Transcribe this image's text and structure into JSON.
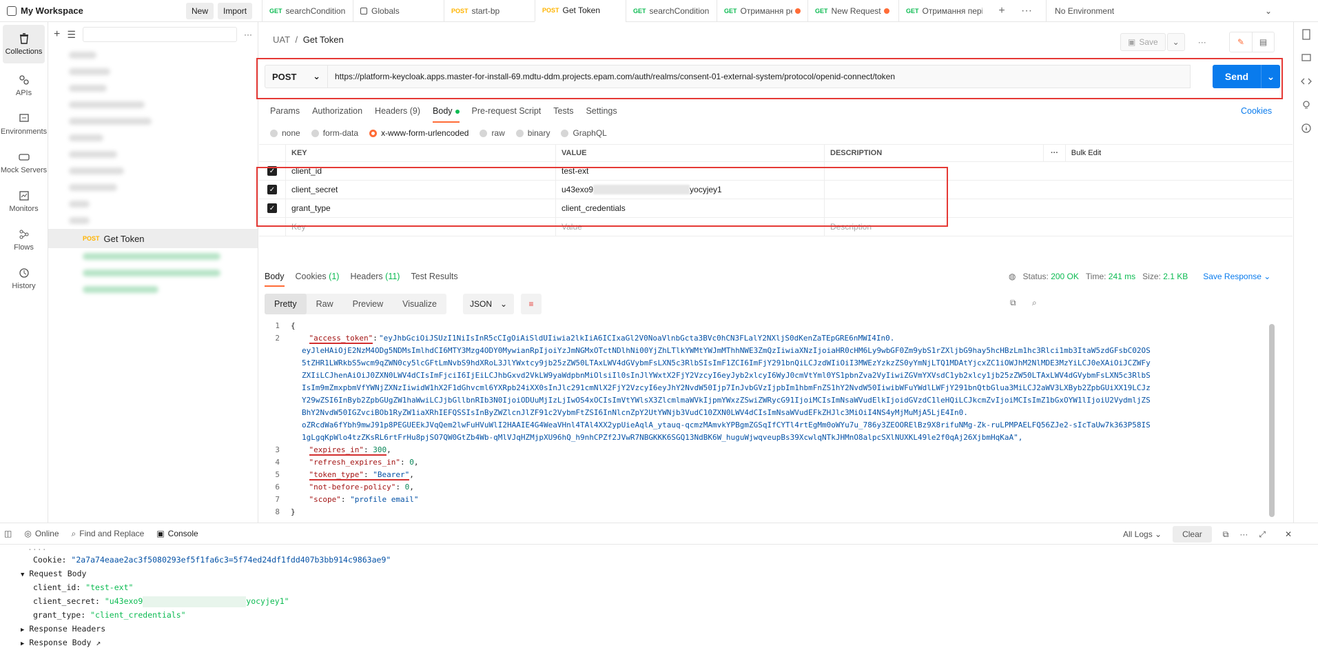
{
  "topbar": {
    "workspace": "My Workspace",
    "new_label": "New",
    "import_label": "Import",
    "tabs": [
      {
        "method": "GET",
        "name": "searchConditionB",
        "dot": false
      },
      {
        "method": "",
        "name": "Globals",
        "dot": false
      },
      {
        "method": "POST",
        "name": "start-bp",
        "dot": false
      },
      {
        "method": "POST",
        "name": "Get Token",
        "dot": false
      },
      {
        "method": "GET",
        "name": "searchConditionB",
        "dot": false
      },
      {
        "method": "GET",
        "name": "Отримання ре",
        "dot": true
      },
      {
        "method": "GET",
        "name": "New Request",
        "dot": true
      },
      {
        "method": "GET",
        "name": "Отримання періо",
        "dot": false
      }
    ],
    "environment": "No Environment"
  },
  "rail": {
    "items": [
      "Collections",
      "APIs",
      "Environments",
      "Mock Servers",
      "Monitors",
      "Flows",
      "History"
    ]
  },
  "sidebar": {
    "selected_method": "POST",
    "selected_name": "Get Token"
  },
  "request": {
    "breadcrumb_parent": "UAT",
    "breadcrumb_sep": "/",
    "breadcrumb_name": "Get Token",
    "save_label": "Save",
    "method": "POST",
    "url": "https://platform-keycloak.apps.master-for-install-69.mdtu-ddm.projects.epam.com/auth/realms/consent-01-external-system/protocol/openid-connect/token",
    "send_label": "Send",
    "tabs": [
      "Params",
      "Authorization",
      "Headers (9)",
      "Body",
      "Pre-request Script",
      "Tests",
      "Settings"
    ],
    "cookies_label": "Cookies",
    "body_types": [
      "none",
      "form-data",
      "x-www-form-urlencoded",
      "raw",
      "binary",
      "GraphQL"
    ],
    "kv_headers": {
      "key": "KEY",
      "value": "VALUE",
      "description": "DESCRIPTION",
      "bulk": "Bulk Edit"
    },
    "rows": [
      {
        "key": "client_id",
        "value": "test-ext"
      },
      {
        "key": "client_secret",
        "value_start": "u43exo9",
        "value_end": "yocyjey1"
      },
      {
        "key": "grant_type",
        "value": "client_credentials"
      }
    ],
    "placeholder_key": "Key",
    "placeholder_value": "Value",
    "placeholder_desc": "Description"
  },
  "response": {
    "tabs": {
      "body": "Body",
      "cookies": "Cookies",
      "cookies_count": "(1)",
      "headers": "Headers",
      "headers_count": "(11)",
      "tests": "Test Results"
    },
    "status_label": "Status:",
    "status": "200 OK",
    "time_label": "Time:",
    "time": "241 ms",
    "size_label": "Size:",
    "size": "2.1 KB",
    "save_response": "Save Response",
    "view_modes": [
      "Pretty",
      "Raw",
      "Preview",
      "Visualize"
    ],
    "format": "JSON",
    "lines": {
      "l1": "{",
      "access_token_key": "\"access_token\"",
      "access_token_val": "\"eyJhbGciOiJSUzI1NiIsInR5cCIgOiAiSldUIiwia2lkIiA6ICIxaGl2V0NoaVlnbGcta3BVc0hCN3FLalY2NXljS0dKenZaTEpGRE6nMWI4In0.\neyJleHAiOjE2NzM4ODg5NDMsImlhdCI6MTY3Mzg4ODY0MywianRpIjoiYzJmNGMxOTctNDlhNi00YjZhLTlkYWMtYWJmMThhNWE3ZmQzIiwiaXNzIjoiaHR0cHM6Ly9wbGF0Zm9ybS1rZXljbG9hay5hcHBzLm1hc3Rlci1mb3ItaW5zdGFsbC02OS\n5tZHR1LWRkbS5wcm9qZWN0cy5lcGFtLmNvbS9hdXRoL3JlYWxtcy9jb25zZW50LTAxLWV4dGVybmFsLXN5c3RlbSIsImF1ZCI6ImFjY291bnQiLCJzdWIiOiI3MWEzYzkzZS0yYmNjLTQ1MDAtYjcxZC1iOWJhM2NlMDE3MzYiLCJ0eXAiOiJCZWFy\nZXIiLCJhenAiOiJ0ZXN0LWV4dCIsImFjciI6IjEiLCJhbGxvd2VkLW9yaWdpbnMiOlsiIl0sInJlYWxtX2FjY2VzcyI6eyJyb2xlcyI6WyJ0cmVtYml0YS1pbnZva2VyIiwiZGVmYXVsdC1yb2xlcy1jb25zZW50LTAxLWV4dGVybmFsLXN5c3RlbS\nIsIm9mZmxpbmVfYWNjZXNzIiwidW1hX2F1dGhvcml6YXRpb24iXX0sInJlc291cmNlX2FjY2VzcyI6eyJhY2NvdW50Ijp7InJvbGVzIjpbIm1hbmFnZS1hY2NvdW50IiwibWFuYWdlLWFjY291bnQtbGlua3MiLCJ2aWV3LXByb2ZpbGUiXX19LCJz\nY29wZSI6InByb2ZpbGUgZW1haWwiLCJjbGllbnRIb3N0IjoiODUuMjIzLjIwOS4xOCIsImVtYWlsX3ZlcmlmaWVkIjpmYWxzZSwiZWRycG91IjoiMCIsImNsaWVudElkIjoidGVzdC1leHQiLCJkcmZvIjoiMCIsImZ1bGxOYW1lIjoiU2VydmljZS\nBhY2NvdW50IGZvciBOb1RyZW1iaXRhIEFQSSIsInByZWZlcnJlZF91c2VybmFtZSI6InNlcnZpY2UtYWNjb3VudC10ZXN0LWV4dCIsImNsaWVudEFkZHJlc3MiOiI4NS4yMjMuMjA5LjE4In0.\noZRcdWa6fYbh9mwJ91p8PEGUEEkJVqQem2lwFuHVuWlI2HAAIE4G4WeaVHnl4TAl4XX2ypUieAqlA_ytauq-qcmzMAmvkYPBgmZGSqIfCYTl4rtEgMm0oWYu7u_786y3ZEOORElBz9X8rifuNMg-Zk-ruLPMPAELFQ56ZJe2-sIcTaUw7k363P58IS\n1gLgqKpWlo4tzZKsRL6rtFrHu8pjSO7QW0GtZb4Wb-qMlVJqHZMjpXU96hQ_h9nhCPZf2JVwR7NBGKKK6SGQ13NdBK6W_huguWjwqveupBs39XcwlqNTkJHMnO8alpcSXlNUXKL49le2f0qAj26XjbmHqKaA\",",
      "expires_in_key": "\"expires_in\"",
      "expires_in_val": "300",
      "refresh_key": "\"refresh_expires_in\"",
      "refresh_val": "0",
      "token_type_key": "\"token_type\"",
      "token_type_val": "\"Bearer\"",
      "nbp_key": "\"not-before-policy\"",
      "nbp_val": "0",
      "scope_key": "\"scope\"",
      "scope_val": "\"profile email\"",
      "last": "}"
    }
  },
  "console": {
    "online": "Online",
    "find_replace": "Find and Replace",
    "console": "Console",
    "all_logs": "All Logs",
    "clear": "Clear",
    "cookie_label": "Cookie:",
    "cookie_value": "\"2a7a74eaae2ac3f5080293ef5f1fa6c3=5f74ed24df1fdd407b3bb914c9863ae9\"",
    "request_body": "Request Body",
    "client_id_label": "client_id:",
    "client_id_value": "\"test-ext\"",
    "client_secret_label": "client_secret:",
    "client_secret_start": "\"u43exo9",
    "client_secret_end": "yocyjey1\"",
    "grant_type_label": "grant_type:",
    "grant_type_value": "\"client_credentials\"",
    "response_headers": "Response Headers",
    "response_body": "Response Body ↗"
  }
}
